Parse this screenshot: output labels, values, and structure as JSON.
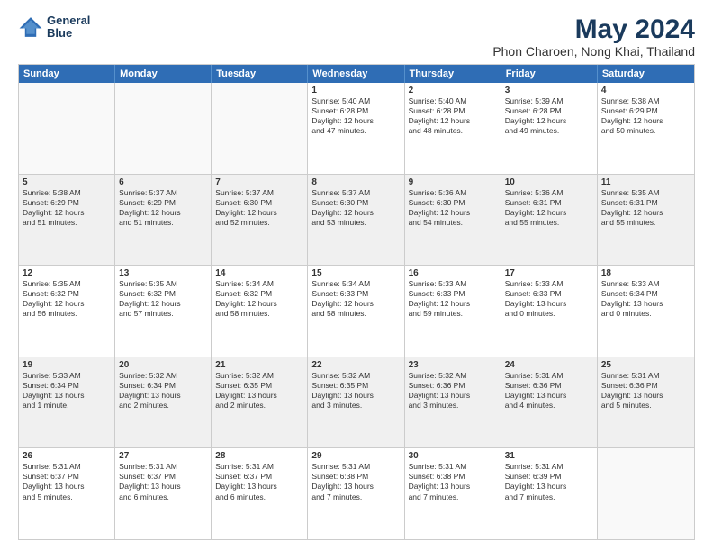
{
  "logo": {
    "line1": "General",
    "line2": "Blue"
  },
  "title": "May 2024",
  "location": "Phon Charoen, Nong Khai, Thailand",
  "weekdays": [
    "Sunday",
    "Monday",
    "Tuesday",
    "Wednesday",
    "Thursday",
    "Friday",
    "Saturday"
  ],
  "rows": [
    [
      {
        "day": "",
        "text": ""
      },
      {
        "day": "",
        "text": ""
      },
      {
        "day": "",
        "text": ""
      },
      {
        "day": "1",
        "text": "Sunrise: 5:40 AM\nSunset: 6:28 PM\nDaylight: 12 hours\nand 47 minutes."
      },
      {
        "day": "2",
        "text": "Sunrise: 5:40 AM\nSunset: 6:28 PM\nDaylight: 12 hours\nand 48 minutes."
      },
      {
        "day": "3",
        "text": "Sunrise: 5:39 AM\nSunset: 6:28 PM\nDaylight: 12 hours\nand 49 minutes."
      },
      {
        "day": "4",
        "text": "Sunrise: 5:38 AM\nSunset: 6:29 PM\nDaylight: 12 hours\nand 50 minutes."
      }
    ],
    [
      {
        "day": "5",
        "text": "Sunrise: 5:38 AM\nSunset: 6:29 PM\nDaylight: 12 hours\nand 51 minutes."
      },
      {
        "day": "6",
        "text": "Sunrise: 5:37 AM\nSunset: 6:29 PM\nDaylight: 12 hours\nand 51 minutes."
      },
      {
        "day": "7",
        "text": "Sunrise: 5:37 AM\nSunset: 6:30 PM\nDaylight: 12 hours\nand 52 minutes."
      },
      {
        "day": "8",
        "text": "Sunrise: 5:37 AM\nSunset: 6:30 PM\nDaylight: 12 hours\nand 53 minutes."
      },
      {
        "day": "9",
        "text": "Sunrise: 5:36 AM\nSunset: 6:30 PM\nDaylight: 12 hours\nand 54 minutes."
      },
      {
        "day": "10",
        "text": "Sunrise: 5:36 AM\nSunset: 6:31 PM\nDaylight: 12 hours\nand 55 minutes."
      },
      {
        "day": "11",
        "text": "Sunrise: 5:35 AM\nSunset: 6:31 PM\nDaylight: 12 hours\nand 55 minutes."
      }
    ],
    [
      {
        "day": "12",
        "text": "Sunrise: 5:35 AM\nSunset: 6:32 PM\nDaylight: 12 hours\nand 56 minutes."
      },
      {
        "day": "13",
        "text": "Sunrise: 5:35 AM\nSunset: 6:32 PM\nDaylight: 12 hours\nand 57 minutes."
      },
      {
        "day": "14",
        "text": "Sunrise: 5:34 AM\nSunset: 6:32 PM\nDaylight: 12 hours\nand 58 minutes."
      },
      {
        "day": "15",
        "text": "Sunrise: 5:34 AM\nSunset: 6:33 PM\nDaylight: 12 hours\nand 58 minutes."
      },
      {
        "day": "16",
        "text": "Sunrise: 5:33 AM\nSunset: 6:33 PM\nDaylight: 12 hours\nand 59 minutes."
      },
      {
        "day": "17",
        "text": "Sunrise: 5:33 AM\nSunset: 6:33 PM\nDaylight: 13 hours\nand 0 minutes."
      },
      {
        "day": "18",
        "text": "Sunrise: 5:33 AM\nSunset: 6:34 PM\nDaylight: 13 hours\nand 0 minutes."
      }
    ],
    [
      {
        "day": "19",
        "text": "Sunrise: 5:33 AM\nSunset: 6:34 PM\nDaylight: 13 hours\nand 1 minute."
      },
      {
        "day": "20",
        "text": "Sunrise: 5:32 AM\nSunset: 6:34 PM\nDaylight: 13 hours\nand 2 minutes."
      },
      {
        "day": "21",
        "text": "Sunrise: 5:32 AM\nSunset: 6:35 PM\nDaylight: 13 hours\nand 2 minutes."
      },
      {
        "day": "22",
        "text": "Sunrise: 5:32 AM\nSunset: 6:35 PM\nDaylight: 13 hours\nand 3 minutes."
      },
      {
        "day": "23",
        "text": "Sunrise: 5:32 AM\nSunset: 6:36 PM\nDaylight: 13 hours\nand 3 minutes."
      },
      {
        "day": "24",
        "text": "Sunrise: 5:31 AM\nSunset: 6:36 PM\nDaylight: 13 hours\nand 4 minutes."
      },
      {
        "day": "25",
        "text": "Sunrise: 5:31 AM\nSunset: 6:36 PM\nDaylight: 13 hours\nand 5 minutes."
      }
    ],
    [
      {
        "day": "26",
        "text": "Sunrise: 5:31 AM\nSunset: 6:37 PM\nDaylight: 13 hours\nand 5 minutes."
      },
      {
        "day": "27",
        "text": "Sunrise: 5:31 AM\nSunset: 6:37 PM\nDaylight: 13 hours\nand 6 minutes."
      },
      {
        "day": "28",
        "text": "Sunrise: 5:31 AM\nSunset: 6:37 PM\nDaylight: 13 hours\nand 6 minutes."
      },
      {
        "day": "29",
        "text": "Sunrise: 5:31 AM\nSunset: 6:38 PM\nDaylight: 13 hours\nand 7 minutes."
      },
      {
        "day": "30",
        "text": "Sunrise: 5:31 AM\nSunset: 6:38 PM\nDaylight: 13 hours\nand 7 minutes."
      },
      {
        "day": "31",
        "text": "Sunrise: 5:31 AM\nSunset: 6:39 PM\nDaylight: 13 hours\nand 7 minutes."
      },
      {
        "day": "",
        "text": ""
      }
    ]
  ]
}
